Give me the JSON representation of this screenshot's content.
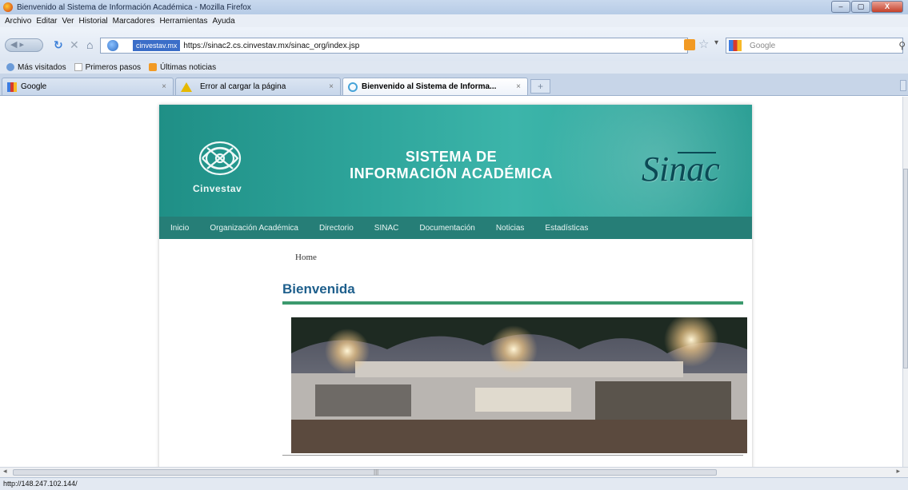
{
  "window": {
    "title": "Bienvenido al Sistema de Información Académica - Mozilla Firefox",
    "min": "–",
    "max": "▢",
    "close": "X"
  },
  "menu": [
    "Archivo",
    "Editar",
    "Ver",
    "Historial",
    "Marcadores",
    "Herramientas",
    "Ayuda"
  ],
  "toolbar": {
    "site_identity": "cinvestav.mx",
    "url": "https://sinac2.cs.cinvestav.mx/sinac_org/index.jsp",
    "search_placeholder": "Google"
  },
  "bookmarks": [
    {
      "label": "Más visitados",
      "icon": "globe-icon"
    },
    {
      "label": "Primeros pasos",
      "icon": "page-icon"
    },
    {
      "label": "Últimas noticias",
      "icon": "rss-icon"
    }
  ],
  "tabs": [
    {
      "label": "Google",
      "icon": "google-favicon",
      "active": false
    },
    {
      "label": "Error al cargar la página",
      "icon": "warning-icon",
      "active": false
    },
    {
      "label": "Bienvenido al Sistema de Informa...",
      "icon": "loading-icon",
      "active": true
    }
  ],
  "site": {
    "logo_text": "Cinvestav",
    "banner_title_line1": "SISTEMA DE",
    "banner_title_line2": "INFORMACIÓN ACADÉMICA",
    "brand_logo": "Sinac",
    "nav": [
      "Inicio",
      "Organización Académica",
      "Directorio",
      "SINAC",
      "Documentación",
      "Noticias",
      "Estadísticas"
    ],
    "breadcrumb": "Home",
    "page_title": "Bienvenida"
  },
  "statusbar": {
    "text": "http://148.247.102.144/"
  },
  "colors": {
    "banner": "#2ea59b",
    "nav_bar": "#267e77",
    "title": "#1e5f8c",
    "title_rule": "#3c9a6e"
  }
}
